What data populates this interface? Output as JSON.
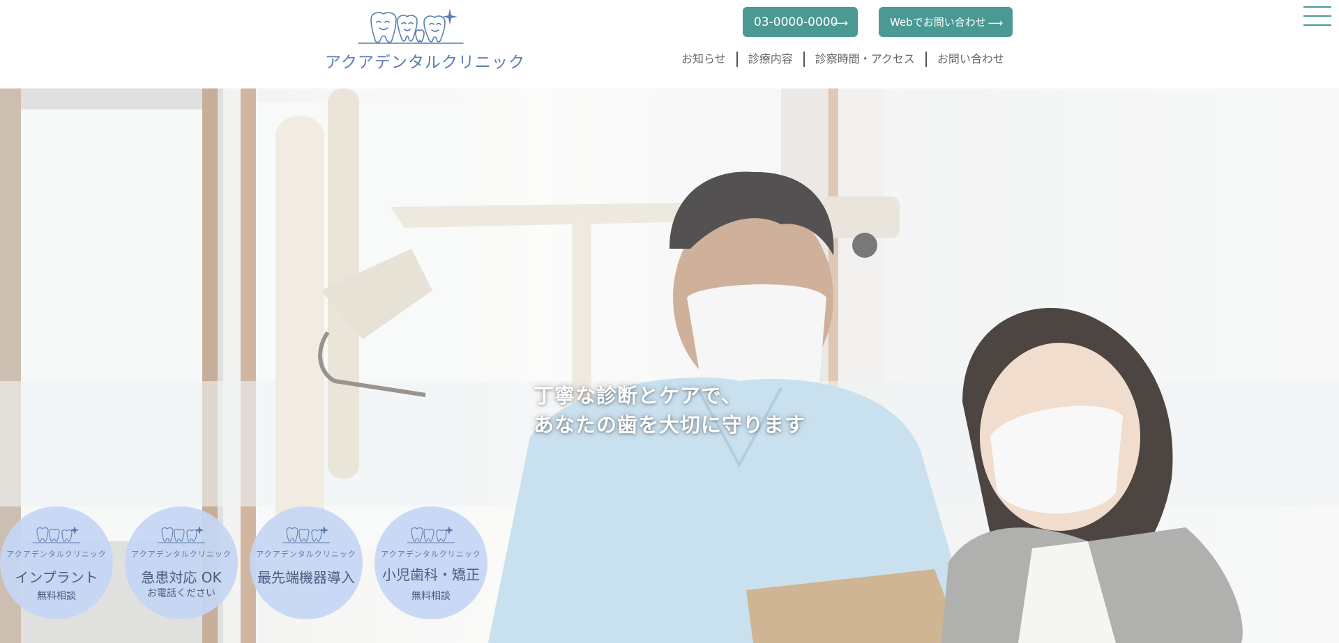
{
  "brand": {
    "name": "アクアデンタルクリニック",
    "color": "#5a7db3",
    "accent": "#4a9993"
  },
  "header": {
    "tel_label": "03-0000-0000",
    "web_label": "Webでお問い合わせ",
    "arrow_icon": "long-arrow-right-icon"
  },
  "nav": {
    "items": [
      {
        "label": "お知らせ"
      },
      {
        "label": "診療内容"
      },
      {
        "label": "診察時間・アクセス"
      },
      {
        "label": "お問い合わせ"
      }
    ],
    "menu_icon": "hamburger-menu-icon"
  },
  "hero": {
    "copy_line1": "丁寧な診断とケアで、",
    "copy_line2": "あなたの歯を大切に守ります"
  },
  "badges": [
    {
      "clinic": "アクアデンタルクリニック",
      "title": "インプラント",
      "sub": "無料相談"
    },
    {
      "clinic": "アクアデンタルクリニック",
      "title": "急患対応 OK",
      "sub": "お電話ください"
    },
    {
      "clinic": "アクアデンタルクリニック",
      "title": "最先端機器導入",
      "sub": ""
    },
    {
      "clinic": "アクアデンタルクリニック",
      "title": "小児歯科・矯正",
      "sub": "無料相談"
    }
  ]
}
